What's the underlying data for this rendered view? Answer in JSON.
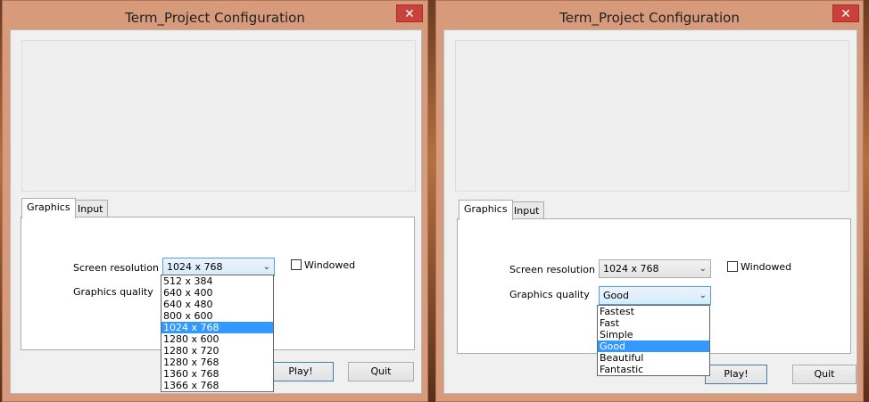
{
  "window": {
    "title": "Term_Project Configuration",
    "close_glyph": "✕"
  },
  "tabs": {
    "graphics": "Graphics",
    "input": "Input"
  },
  "fields": {
    "screen_resolution": "Screen resolution",
    "graphics_quality": "Graphics quality",
    "windowed": "Windowed"
  },
  "buttons": {
    "play": "Play!",
    "quit": "Quit"
  },
  "left": {
    "resolution_value": "1024 x 768",
    "resolution_options": [
      "512 x 384",
      "640 x 400",
      "640 x 480",
      "800 x 600",
      "1024 x 768",
      "1280 x 600",
      "1280 x 720",
      "1280 x 768",
      "1360 x 768",
      "1366 x 768"
    ],
    "selected_index": 4
  },
  "right": {
    "resolution_value": "1024 x 768",
    "quality_value": "Good",
    "quality_options": [
      "Fastest",
      "Fast",
      "Simple",
      "Good",
      "Beautiful",
      "Fantastic"
    ],
    "selected_index": 3
  },
  "icons": {
    "dropdown_arrow": "chevron-down-icon",
    "close": "close-icon"
  },
  "colors": {
    "titlebar": "#d79a7a",
    "close_button": "#c9413a",
    "selection": "#3399ff"
  }
}
